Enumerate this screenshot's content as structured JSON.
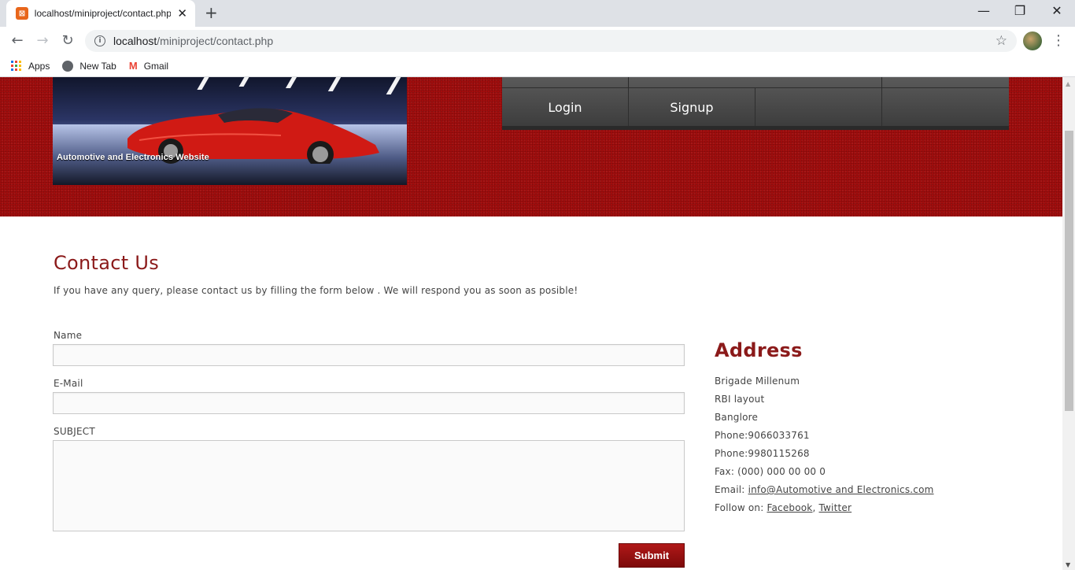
{
  "browser": {
    "tab_title": "localhost/miniproject/contact.php",
    "url_host": "localhost",
    "url_path": "/miniproject/contact.php",
    "bookmarks": [
      {
        "label": "Apps",
        "icon": "apps-grid-icon"
      },
      {
        "label": "New Tab",
        "icon": "globe-icon"
      },
      {
        "label": "Gmail",
        "icon": "gmail-icon"
      }
    ]
  },
  "header": {
    "banner_caption": "Automotive and Electronics Website",
    "menu": [
      {
        "label": "Login"
      },
      {
        "label": "Signup"
      }
    ]
  },
  "contact": {
    "title": "Contact Us",
    "intro": "If you have any query, please contact us by filling the form below . We will respond you as soon as posible!",
    "name_label": "Name",
    "email_label": "E-Mail",
    "subject_label": "SUBJECT",
    "name_value": "",
    "email_value": "",
    "subject_value": "",
    "submit_label": "Submit"
  },
  "address": {
    "title": "Address",
    "line1": "Brigade Millenum",
    "line2": "RBI layout",
    "line3": "Banglore",
    "phone1": "Phone:9066033761",
    "phone2": "Phone:9980115268",
    "fax": "Fax: (000) 000 00 00 0",
    "email_prefix": "Email: ",
    "email_link": "info@Automotive and Electronics.com",
    "follow_prefix": "Follow on: ",
    "facebook": "Facebook",
    "comma": ", ",
    "twitter": "Twitter"
  },
  "colors": {
    "brand_red": "#a10d0d",
    "heading_red": "#8b1a1a",
    "menu_gray": "#4a4a4a"
  }
}
